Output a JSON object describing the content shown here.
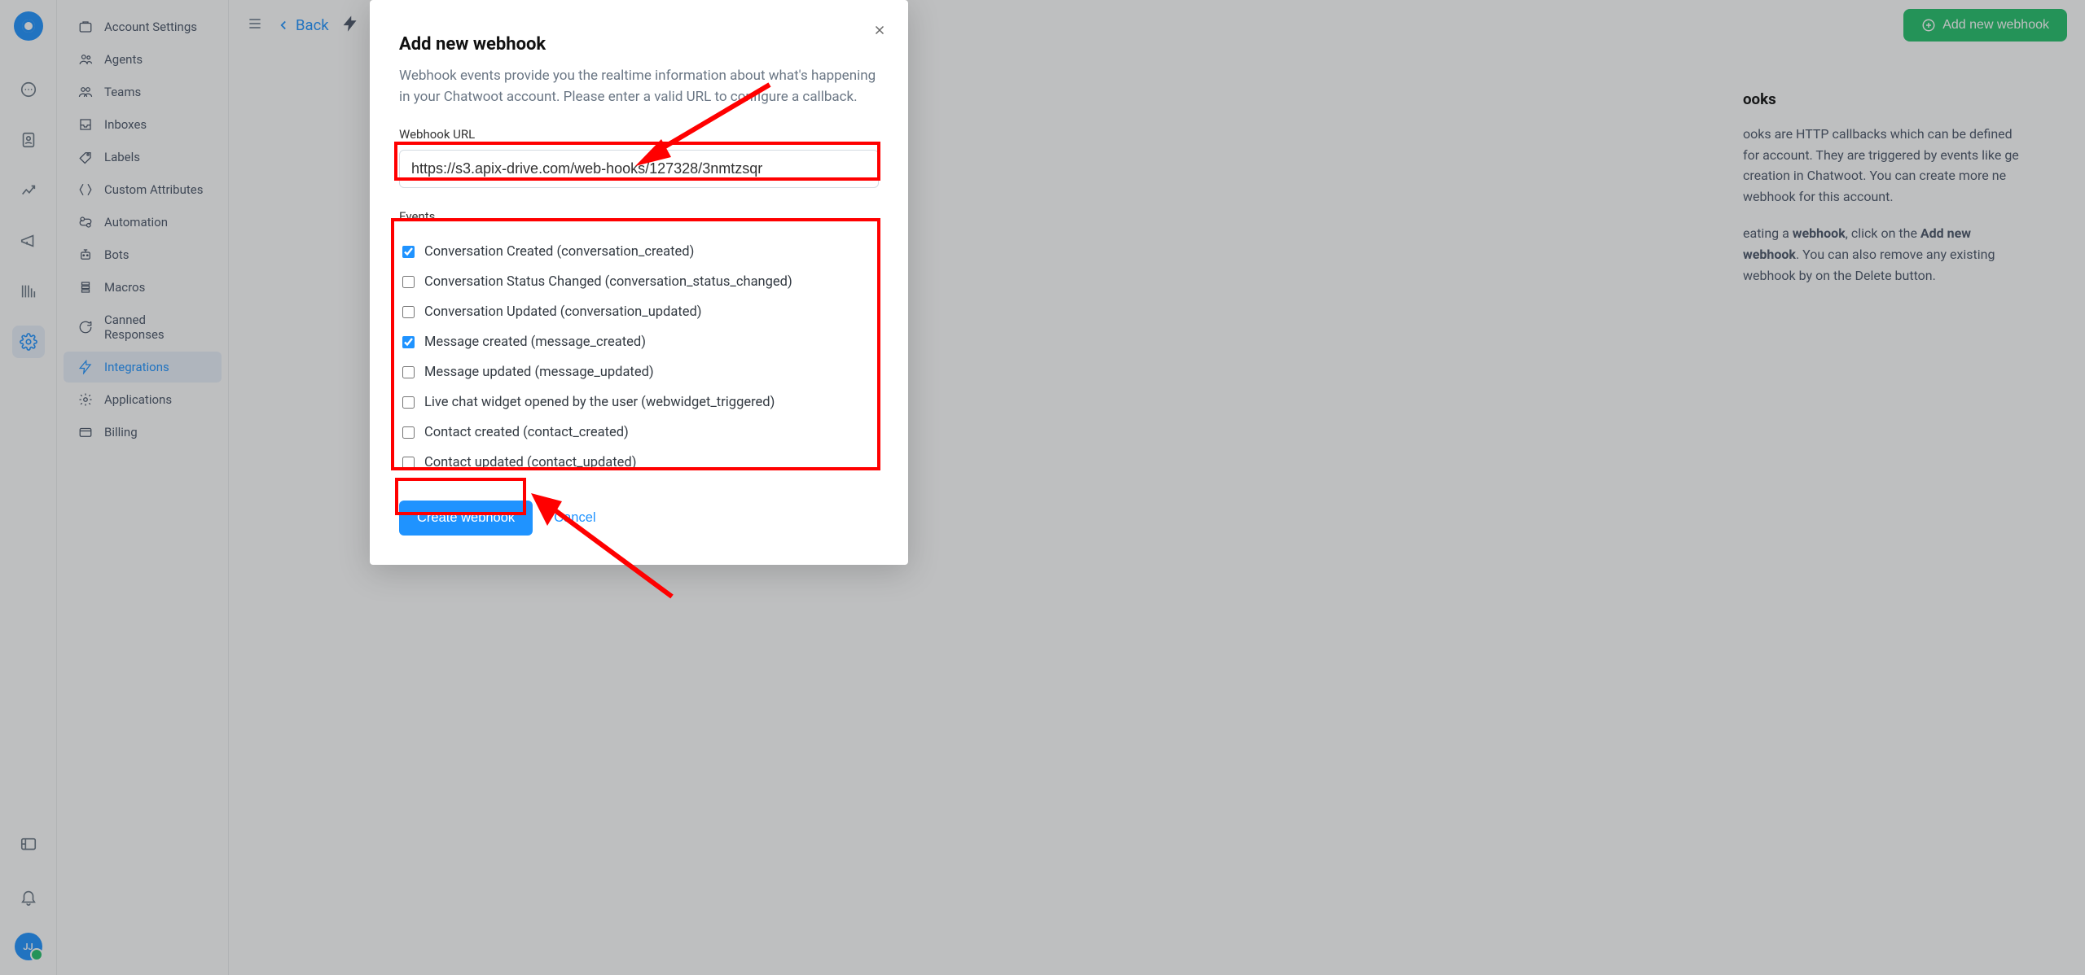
{
  "sidebar": {
    "items": [
      {
        "label": "Account Settings"
      },
      {
        "label": "Agents"
      },
      {
        "label": "Teams"
      },
      {
        "label": "Inboxes"
      },
      {
        "label": "Labels"
      },
      {
        "label": "Custom Attributes"
      },
      {
        "label": "Automation"
      },
      {
        "label": "Bots"
      },
      {
        "label": "Macros"
      },
      {
        "label": "Canned Responses"
      },
      {
        "label": "Integrations"
      },
      {
        "label": "Applications"
      },
      {
        "label": "Billing"
      }
    ]
  },
  "avatar": {
    "initials": "JJ"
  },
  "topbar": {
    "back_label": "Back",
    "add_button": "Add new webhook"
  },
  "background_page": {
    "heading_fragment": "ooks",
    "para1_part1": "ooks are HTTP callbacks which can be defined for account. They are triggered by events like ge creation in Chatwoot. You can create more ne webhook for this account.",
    "para2_prefix": "eating a ",
    "para2_bold1": "webhook",
    "para2_mid": ", click on the ",
    "para2_bold2": "Add new webhook",
    "para2_rest": ". You can also remove any existing webhook by on the Delete button."
  },
  "dialog": {
    "title": "Add new webhook",
    "subtitle": "Webhook events provide you the realtime information about what's happening in your Chatwoot account. Please enter a valid URL to configure a callback.",
    "url_label": "Webhook URL",
    "url_value": "https://s3.apix-drive.com/web-hooks/127328/3nmtzsqr",
    "events_label": "Events",
    "events": [
      {
        "label": "Conversation Created (conversation_created)",
        "checked": true
      },
      {
        "label": "Conversation Status Changed (conversation_status_changed)",
        "checked": false
      },
      {
        "label": "Conversation Updated (conversation_updated)",
        "checked": false
      },
      {
        "label": "Message created (message_created)",
        "checked": true
      },
      {
        "label": "Message updated (message_updated)",
        "checked": false
      },
      {
        "label": "Live chat widget opened by the user (webwidget_triggered)",
        "checked": false
      },
      {
        "label": "Contact created (contact_created)",
        "checked": false
      },
      {
        "label": "Contact updated (contact_updated)",
        "checked": false
      }
    ],
    "create_button": "Create webhook",
    "cancel_button": "Cancel"
  }
}
